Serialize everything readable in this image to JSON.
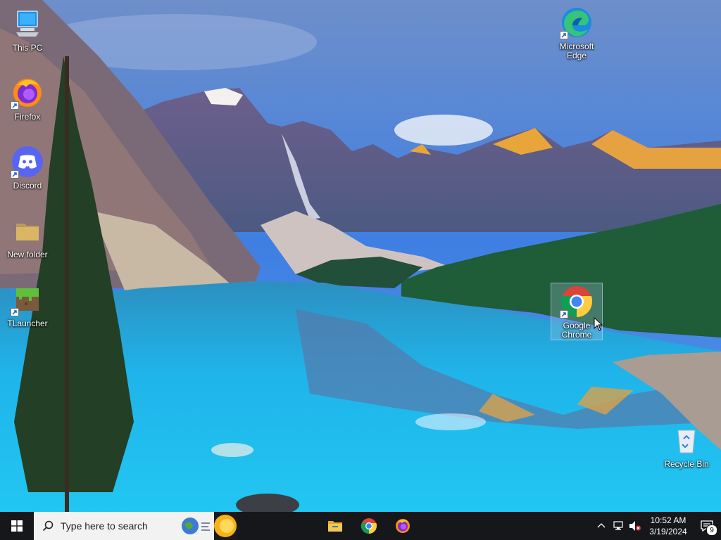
{
  "desktop": {
    "icons": [
      {
        "name": "this-pc",
        "label": "This PC",
        "icon": "computer-icon",
        "shortcut": false
      },
      {
        "name": "firefox",
        "label": "Firefox",
        "icon": "firefox-icon",
        "shortcut": true
      },
      {
        "name": "discord",
        "label": "Discord",
        "icon": "discord-icon",
        "shortcut": true
      },
      {
        "name": "new-folder",
        "label": "New folder",
        "icon": "folder-icon",
        "shortcut": false
      },
      {
        "name": "tlauncher",
        "label": "TLauncher",
        "icon": "minecraft-grass-icon",
        "shortcut": true
      },
      {
        "name": "microsoft-edge",
        "label": "Microsoft Edge",
        "icon": "edge-icon",
        "shortcut": true
      },
      {
        "name": "google-chrome",
        "label": "Google Chrome",
        "icon": "chrome-icon",
        "shortcut": true,
        "selected": true
      },
      {
        "name": "recycle-bin",
        "label": "Recycle Bin",
        "icon": "recycle-bin-icon",
        "shortcut": false
      }
    ]
  },
  "taskbar": {
    "search_placeholder": "Type here to search",
    "pinned_apps": [
      {
        "name": "file-explorer",
        "icon": "folder-icon"
      },
      {
        "name": "google-chrome",
        "icon": "chrome-icon",
        "running": true
      },
      {
        "name": "firefox",
        "icon": "firefox-icon",
        "running": true
      }
    ],
    "clock": {
      "time": "10:52 AM",
      "date": "3/19/2024"
    },
    "notification_count": "9",
    "tray_icons": [
      "chevron-up-icon",
      "network-icon",
      "volume-muted-icon"
    ]
  },
  "colors": {
    "taskbar_bg": "#16171b",
    "search_bg": "#f2f2f2",
    "sky": "#3e7fe0",
    "lake": "#1fb2e6"
  }
}
